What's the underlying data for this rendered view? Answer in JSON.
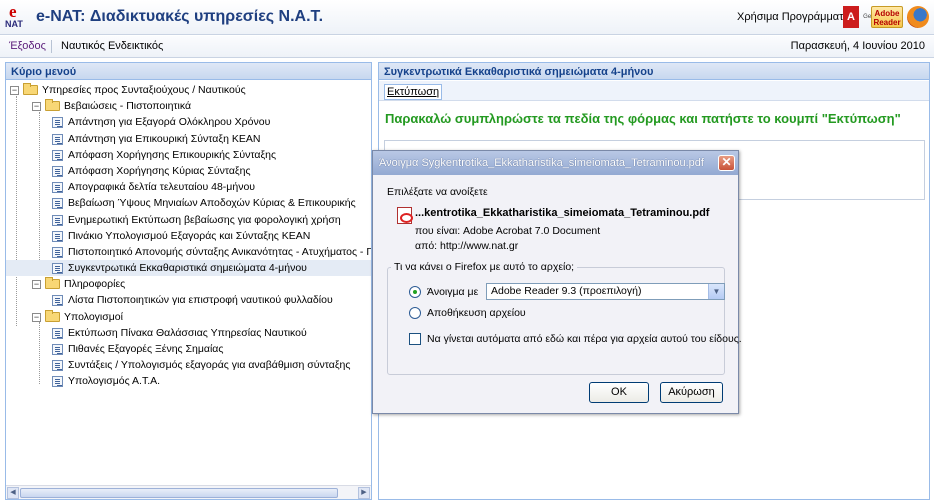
{
  "header": {
    "logo_e": "e",
    "logo_nat": "NAT",
    "title": "e-NAT: Διαδικτυακές υπηρεσίες Ν.Α.Τ.",
    "programs_label": "Χρήσιμα Προγράμματα:",
    "adobe_mark": "A",
    "get_label": "Get",
    "reader_label": "Adobe Reader"
  },
  "nav": {
    "exit": "Έξοδος",
    "link": "Ναυτικός Ενδεικτικός",
    "date": "Παρασκευή, 4 Ιουνίου 2010"
  },
  "left_panel": {
    "title": "Κύριο μενού",
    "tree": [
      {
        "label": "Υπηρεσίες προς Συνταξιούχους / Ναυτικούς",
        "type": "folder",
        "level": 0,
        "expanded": true
      },
      {
        "label": "Βεβαιώσεις - Πιστοποιητικά",
        "type": "folder",
        "level": 1,
        "expanded": true
      },
      {
        "label": "Απάντηση για Εξαγορά Ολόκληρου Χρόνου",
        "type": "item",
        "level": 2
      },
      {
        "label": "Απάντηση για Επικουρική Σύνταξη ΚΕΑΝ",
        "type": "item",
        "level": 2
      },
      {
        "label": "Απόφαση Χορήγησης Επικουρικής Σύνταξης",
        "type": "item",
        "level": 2
      },
      {
        "label": "Απόφαση Χορήγησης Κύριας Σύνταξης",
        "type": "item",
        "level": 2
      },
      {
        "label": "Απογραφικά δελτία τελευταίου 48-μήνου",
        "type": "item",
        "level": 2
      },
      {
        "label": "Βεβαίωση Ύψους Μηνιαίων Αποδοχών Κύριας & Επικουρικής",
        "type": "item",
        "level": 2
      },
      {
        "label": "Ενημερωτική Εκτύπωση βεβαίωσης για φορολογική χρήση",
        "type": "item",
        "level": 2
      },
      {
        "label": "Πινάκιο Υπολογισμού Εξαγοράς και Σύνταξης ΚΕΑΝ",
        "type": "item",
        "level": 2
      },
      {
        "label": "Πιστοποιητικό Απονομής σύνταξης Ανικανότητας - Ατυχήματος - Γήρα",
        "type": "item",
        "level": 2
      },
      {
        "label": "Συγκεντρωτικά Εκκαθαριστικά σημειώματα 4-μήνου",
        "type": "item",
        "level": 2,
        "selected": true
      },
      {
        "label": "Πληροφορίες",
        "type": "folder",
        "level": 1,
        "expanded": true
      },
      {
        "label": "Λίστα Πιστοποιητικών για επιστροφή ναυτικού φυλλαδίου",
        "type": "item",
        "level": 2
      },
      {
        "label": "Υπολογισμοί",
        "type": "folder",
        "level": 1,
        "expanded": true
      },
      {
        "label": "Εκτύπωση Πίνακα Θαλάσσιας Υπηρεσίας Ναυτικού",
        "type": "item",
        "level": 2
      },
      {
        "label": "Πιθανές Εξαγορές Ξένης Σημαίας",
        "type": "item",
        "level": 2
      },
      {
        "label": "Συντάξεις / Υπολογισμός εξαγοράς για αναβάθμιση σύνταξης",
        "type": "item",
        "level": 2
      },
      {
        "label": "Υπολογισμός Α.Τ.Α.",
        "type": "item",
        "level": 2
      }
    ]
  },
  "right_panel": {
    "title": "Συγκεντρωτικά Εκκαθαριστικά σημειώματα 4-μήνου",
    "print_button": "Εκτύπωση",
    "instruction": "Παρακαλώ συμπληρώστε τα πεδία της φόρμας και πατήστε το κουμπί \"Εκτύπωση\""
  },
  "dialog": {
    "title": "Άνοιγμα Sygkentrotika_Ekkatharistika_simeiomata_Tetraminou.pdf",
    "close_glyph": "✕",
    "chosen_to_open": "Επιλέξατε να ανοίξετε",
    "filename": "...kentrotika_Ekkatharistika_simeiomata_Tetraminou.pdf",
    "type_label": "που είναι:",
    "type_value": "Adobe Acrobat 7.0 Document",
    "from_label": "από:",
    "from_value": "http://www.nat.gr",
    "question": "Τι να κάνει ο Firefox  με αυτό το αρχείο;",
    "open_with_label": "Άνοιγμα με",
    "open_with_value": "Adobe Reader 9.3 (προεπιλογή)",
    "save_label": "Αποθήκευση αρχείου",
    "auto_label": "Να γίνεται αυτόματα από εδώ και πέρα για αρχεία αυτού του είδους.",
    "ok": "OK",
    "cancel": "Ακύρωση",
    "open_with_selected": true,
    "auto_checked": false
  }
}
